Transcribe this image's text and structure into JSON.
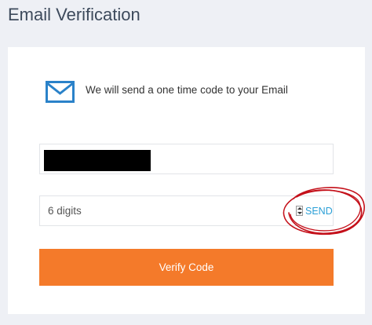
{
  "page": {
    "title": "Email Verification"
  },
  "info": {
    "icon": "mail-icon",
    "text": "We will send a one time code to your Email"
  },
  "email_field": {
    "value_redacted": true
  },
  "code_field": {
    "placeholder": "6 digits",
    "value": ""
  },
  "send_button": {
    "label": "SEND"
  },
  "verify_button": {
    "label": "Verify Code"
  },
  "colors": {
    "background": "#eef0f5",
    "card": "#ffffff",
    "title_text": "#3d4a5c",
    "icon_blue": "#2a82c9",
    "send_link": "#2a9fd6",
    "verify_button": "#f47a2a",
    "annotation_red": "#c4101a"
  }
}
